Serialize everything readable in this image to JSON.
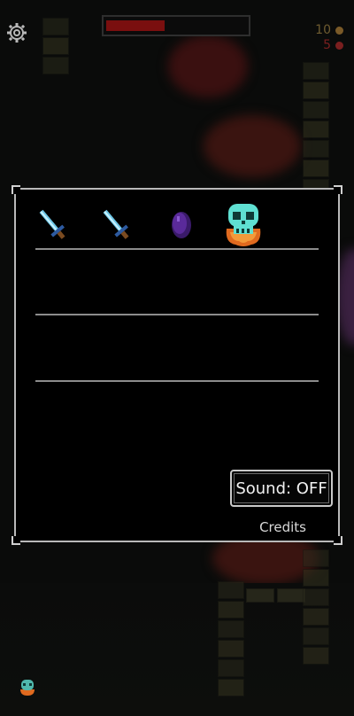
{
  "hud": {
    "settings_icon": "gear-icon",
    "health_fraction": 0.42,
    "health_color": "#7a0f0f",
    "gold": {
      "value": "10",
      "icon": "coin-icon",
      "color": "#7a5a28"
    },
    "gems": {
      "value": "5",
      "icon": "gem-icon",
      "color": "#7a1f1f"
    }
  },
  "inventory": {
    "rows": [
      {
        "items": [
          "blue-sword-icon",
          "blue-sword-icon",
          "purple-egg-icon",
          "flaming-skull-icon"
        ]
      },
      {
        "items": []
      },
      {
        "items": []
      }
    ]
  },
  "menu": {
    "sound_label": "Sound: OFF",
    "credits_label": "Credits"
  },
  "colors": {
    "panel_border": "#b9b9b9",
    "skull": "#5fe0d2",
    "flame": "#e06a1f",
    "sword": "#6ec8e8",
    "egg": "#5a2a9a"
  }
}
